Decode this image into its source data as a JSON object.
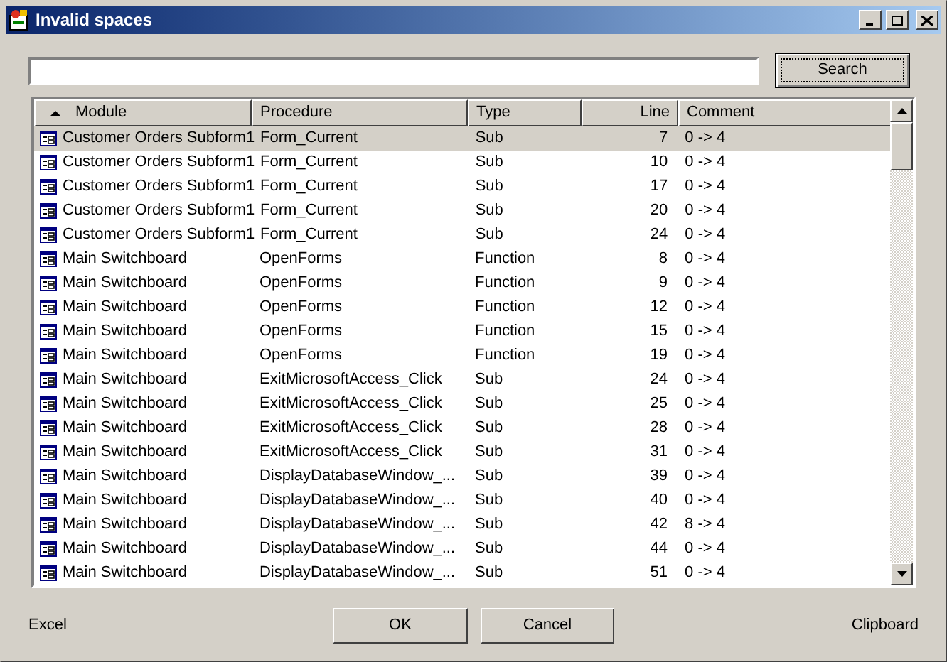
{
  "window": {
    "title": "Invalid spaces"
  },
  "search": {
    "button": "Search"
  },
  "table": {
    "columns": [
      {
        "label": "Module",
        "sorted": true
      },
      {
        "label": "Procedure",
        "sorted": false
      },
      {
        "label": "Type",
        "sorted": false
      },
      {
        "label": "Line",
        "sorted": false
      },
      {
        "label": "Comment",
        "sorted": false
      }
    ],
    "rows": [
      {
        "module": "Customer Orders Subform1",
        "procedure": "Form_Current",
        "type": "Sub",
        "line": "7",
        "comment": "0 -> 4",
        "selected": true
      },
      {
        "module": "Customer Orders Subform1",
        "procedure": "Form_Current",
        "type": "Sub",
        "line": "10",
        "comment": "0 -> 4",
        "selected": false
      },
      {
        "module": "Customer Orders Subform1",
        "procedure": "Form_Current",
        "type": "Sub",
        "line": "17",
        "comment": "0 -> 4",
        "selected": false
      },
      {
        "module": "Customer Orders Subform1",
        "procedure": "Form_Current",
        "type": "Sub",
        "line": "20",
        "comment": "0 -> 4",
        "selected": false
      },
      {
        "module": "Customer Orders Subform1",
        "procedure": "Form_Current",
        "type": "Sub",
        "line": "24",
        "comment": "0 -> 4",
        "selected": false
      },
      {
        "module": "Main Switchboard",
        "procedure": "OpenForms",
        "type": "Function",
        "line": "8",
        "comment": "0 -> 4",
        "selected": false
      },
      {
        "module": "Main Switchboard",
        "procedure": "OpenForms",
        "type": "Function",
        "line": "9",
        "comment": "0 -> 4",
        "selected": false
      },
      {
        "module": "Main Switchboard",
        "procedure": "OpenForms",
        "type": "Function",
        "line": "12",
        "comment": "0 -> 4",
        "selected": false
      },
      {
        "module": "Main Switchboard",
        "procedure": "OpenForms",
        "type": "Function",
        "line": "15",
        "comment": "0 -> 4",
        "selected": false
      },
      {
        "module": "Main Switchboard",
        "procedure": "OpenForms",
        "type": "Function",
        "line": "19",
        "comment": "0 -> 4",
        "selected": false
      },
      {
        "module": "Main Switchboard",
        "procedure": "ExitMicrosoftAccess_Click",
        "type": "Sub",
        "line": "24",
        "comment": "0 -> 4",
        "selected": false
      },
      {
        "module": "Main Switchboard",
        "procedure": "ExitMicrosoftAccess_Click",
        "type": "Sub",
        "line": "25",
        "comment": "0 -> 4",
        "selected": false
      },
      {
        "module": "Main Switchboard",
        "procedure": "ExitMicrosoftAccess_Click",
        "type": "Sub",
        "line": "28",
        "comment": "0 -> 4",
        "selected": false
      },
      {
        "module": "Main Switchboard",
        "procedure": "ExitMicrosoftAccess_Click",
        "type": "Sub",
        "line": "31",
        "comment": "0 -> 4",
        "selected": false
      },
      {
        "module": "Main Switchboard",
        "procedure": "DisplayDatabaseWindow_...",
        "type": "Sub",
        "line": "39",
        "comment": "0 -> 4",
        "selected": false
      },
      {
        "module": "Main Switchboard",
        "procedure": "DisplayDatabaseWindow_...",
        "type": "Sub",
        "line": "40",
        "comment": "0 -> 4",
        "selected": false
      },
      {
        "module": "Main Switchboard",
        "procedure": "DisplayDatabaseWindow_...",
        "type": "Sub",
        "line": "42",
        "comment": "8 -> 4",
        "selected": false
      },
      {
        "module": "Main Switchboard",
        "procedure": "DisplayDatabaseWindow_...",
        "type": "Sub",
        "line": "44",
        "comment": "0 -> 4",
        "selected": false
      },
      {
        "module": "Main Switchboard",
        "procedure": "DisplayDatabaseWindow_...",
        "type": "Sub",
        "line": "51",
        "comment": "0 -> 4",
        "selected": false
      }
    ]
  },
  "footer": {
    "excel": "Excel",
    "ok": "OK",
    "cancel": "Cancel",
    "clipboard": "Clipboard"
  }
}
